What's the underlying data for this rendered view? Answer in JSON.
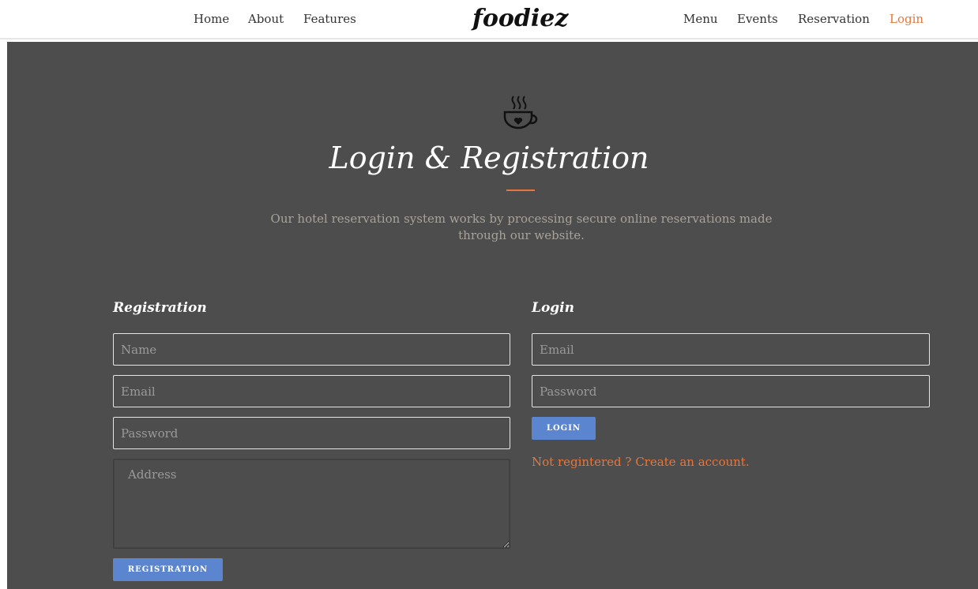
{
  "nav": {
    "left": [
      "Home",
      "About",
      "Features"
    ],
    "logo": "foodiez",
    "right": [
      "Menu",
      "Events",
      "Reservation",
      "Login"
    ],
    "active_color": "#e8763a"
  },
  "hero": {
    "icon": "coffee-cup-heart-icon",
    "title": "Login & Registration",
    "subtitle": "Our hotel reservation system works by processing secure online reservations made through our website."
  },
  "registration": {
    "heading": "Registration",
    "name_placeholder": "Name",
    "email_placeholder": "Email",
    "password_placeholder": "Password",
    "address_placeholder": "Address",
    "button_label": "REGISTRATION"
  },
  "login": {
    "heading": "Login",
    "email_placeholder": "Email",
    "password_placeholder": "Password",
    "button_label": "LOGIN",
    "create_account_text": "Not regintered ? Create an account."
  },
  "colors": {
    "accent": "#e8763a",
    "button": "#5b86cf",
    "background": "#4d4d4d"
  }
}
